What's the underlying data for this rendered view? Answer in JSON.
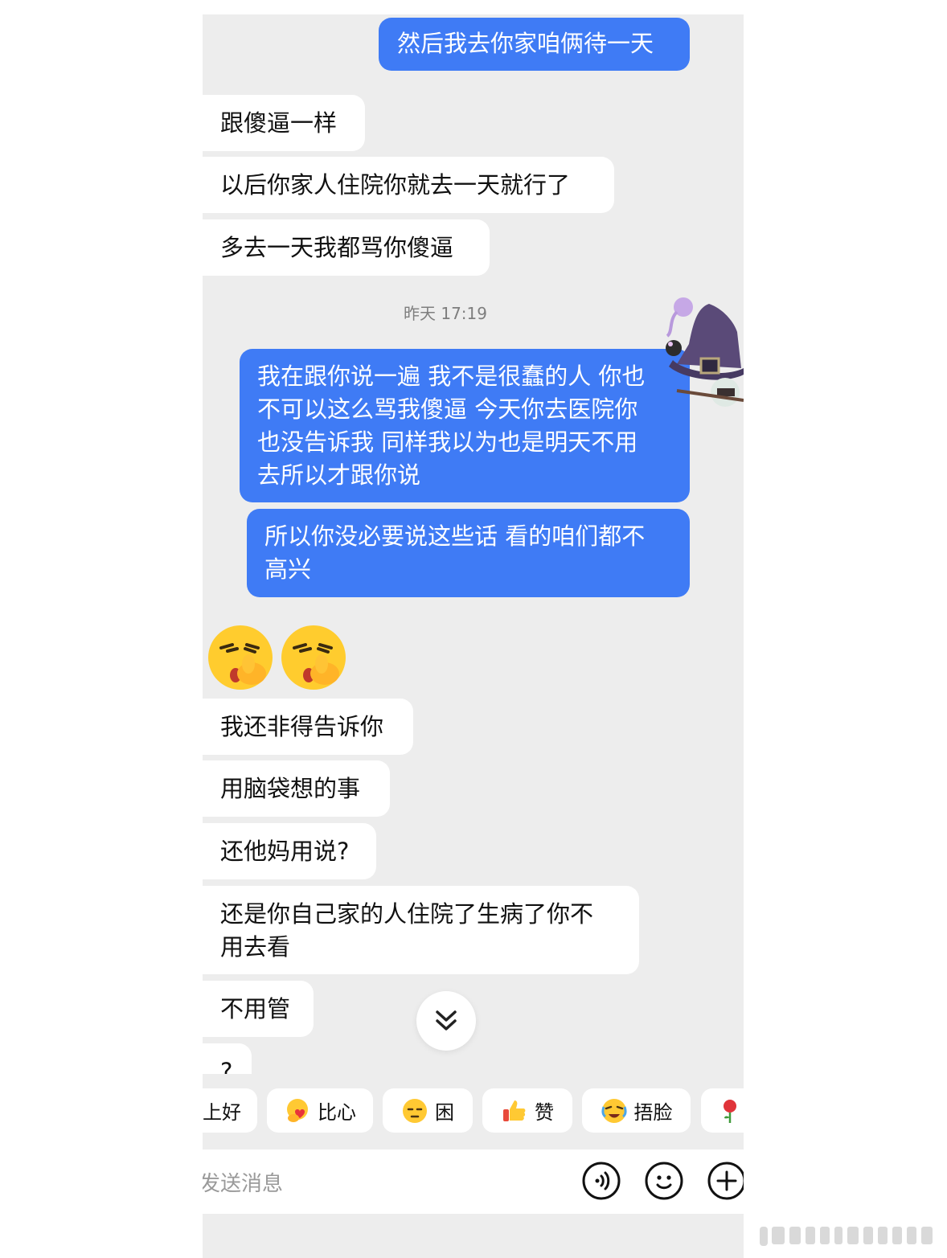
{
  "messages": [
    {
      "side": "out",
      "text": "然后我去你家咱俩待一天"
    },
    {
      "side": "in",
      "text": "跟傻逼一样"
    },
    {
      "side": "in",
      "text": "以后你家人住院你就去一天就行了"
    },
    {
      "side": "in",
      "text": "多去一天我都骂你傻逼"
    },
    {
      "side": "out",
      "text": "我在跟你说一遍 我不是很蠢的人 你也\n不可以这么骂我傻逼 今天你去医院你\n也没告诉我 同样我以为也是明天不用\n去所以才跟你说"
    },
    {
      "side": "out",
      "text": "所以你没必要说这些话 看的咱们都不\n高兴"
    },
    {
      "side": "in",
      "text": "我还非得告诉你"
    },
    {
      "side": "in",
      "text": "用脑袋想的事"
    },
    {
      "side": "in",
      "text": "还他妈用说?"
    },
    {
      "side": "in",
      "text": "还是你自己家的人住院了生病了你不\n用去看"
    },
    {
      "side": "in",
      "text": "不用管"
    },
    {
      "side": "in",
      "text": "?"
    }
  ],
  "timestamp": "昨天 17:19",
  "quick_replies": [
    {
      "label": "上好",
      "icon": ""
    },
    {
      "label": "比心",
      "icon": "heart-hands-icon"
    },
    {
      "label": "困",
      "icon": "sleepy-face-icon"
    },
    {
      "label": "赞",
      "icon": "thumbs-up-icon"
    },
    {
      "label": "捂脸",
      "icon": "facepalm-icon"
    },
    {
      "label": "",
      "icon": "rose-icon"
    }
  ],
  "input": {
    "placeholder": "发送消息"
  },
  "colors": {
    "outgoing_bubble": "#3f7bf5",
    "incoming_bubble": "#ffffff",
    "background": "#ededed"
  }
}
